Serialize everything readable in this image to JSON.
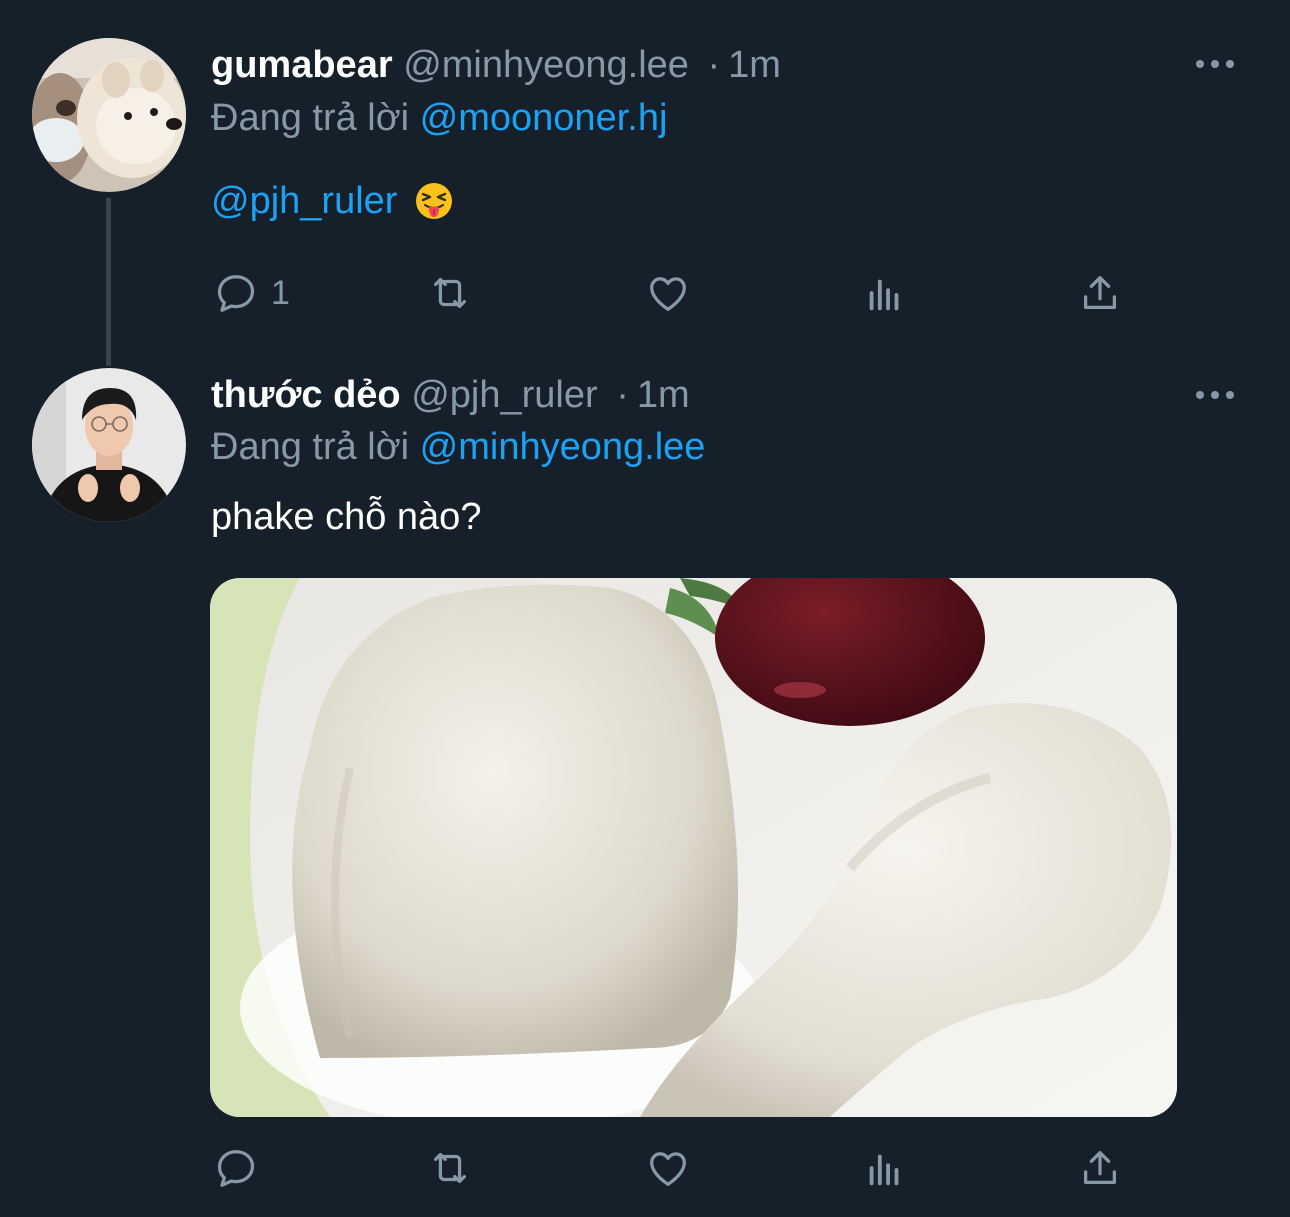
{
  "tweets": [
    {
      "display_name": "gumabear",
      "handle": "@minhyeong.lee",
      "separator": "·",
      "time": "1m",
      "replying_prefix": "Đang trả lời",
      "replying_to": "@moononer.hj",
      "text_mention": "@pjh_ruler",
      "emoji": "squinting-face-with-tongue",
      "reply_count": "1",
      "avatar": "pomeranian-dog-avatar"
    },
    {
      "display_name": "thước dẻo",
      "handle": "@pjh_ruler",
      "separator": "·",
      "time": "1m",
      "replying_prefix": "Đang trả lời",
      "replying_to": "@minhyeong.lee",
      "text": "phake chỗ nào?",
      "reply_count": "",
      "avatar": "young-man-glasses-avatar",
      "media": "rice-shaped-like-chicken-drumstick-photo"
    }
  ],
  "colors": {
    "background": "#15202b",
    "primary_text": "#ffffff",
    "secondary_text": "#8899a6",
    "accent": "#1da1f2",
    "thread_line": "#38444d"
  },
  "icons": [
    "reply-icon",
    "retweet-icon",
    "like-icon",
    "analytics-icon",
    "share-icon",
    "more-icon"
  ]
}
